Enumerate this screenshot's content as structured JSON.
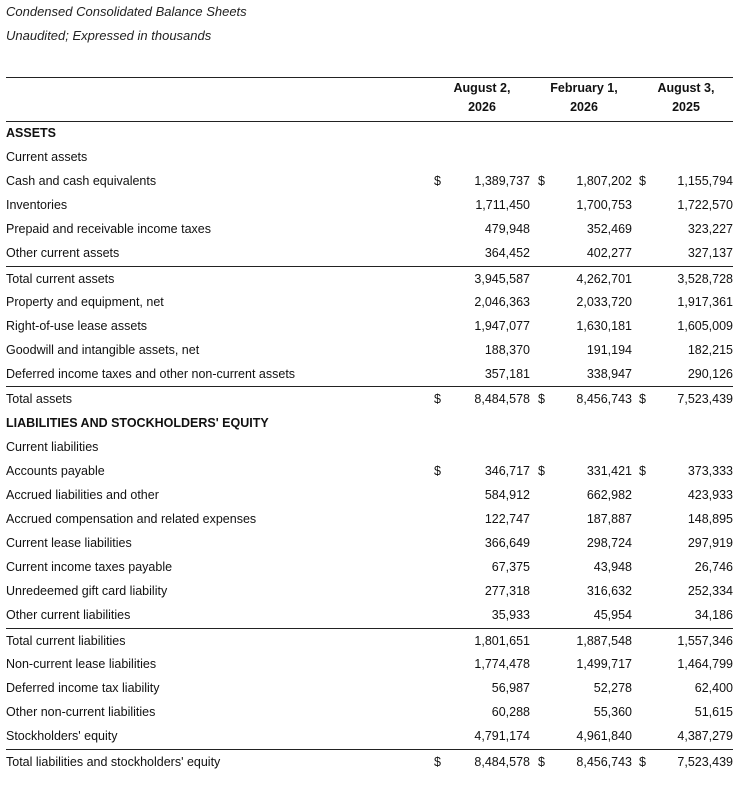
{
  "document": {
    "title": "Condensed Consolidated Balance Sheets",
    "subtitle": "Unaudited; Expressed in thousands"
  },
  "columns": [
    {
      "line1": "August 2,",
      "line2": "2026"
    },
    {
      "line1": "February 1,",
      "line2": "2026"
    },
    {
      "line1": "August 3,",
      "line2": "2025"
    }
  ],
  "rows": [
    {
      "label": "ASSETS",
      "type": "section"
    },
    {
      "label": "Current assets",
      "type": "subsection"
    },
    {
      "label": "Cash and cash equivalents",
      "values": [
        "1,389,737",
        "1,807,202",
        "1,155,794"
      ],
      "currency": [
        "$",
        "$",
        "$"
      ]
    },
    {
      "label": "Inventories",
      "values": [
        "1,711,450",
        "1,700,753",
        "1,722,570"
      ]
    },
    {
      "label": "Prepaid and receivable income taxes",
      "values": [
        "479,948",
        "352,469",
        "323,227"
      ]
    },
    {
      "label": "Other current assets",
      "values": [
        "364,452",
        "402,277",
        "327,137"
      ]
    },
    {
      "label": "Total current assets",
      "values": [
        "3,945,587",
        "4,262,701",
        "3,528,728"
      ],
      "total": true
    },
    {
      "label": "Property and equipment, net",
      "values": [
        "2,046,363",
        "2,033,720",
        "1,917,361"
      ]
    },
    {
      "label": "Right-of-use lease assets",
      "values": [
        "1,947,077",
        "1,630,181",
        "1,605,009"
      ]
    },
    {
      "label": "Goodwill and intangible assets, net",
      "values": [
        "188,370",
        "191,194",
        "182,215"
      ]
    },
    {
      "label": "Deferred income taxes and other non-current assets",
      "values": [
        "357,181",
        "338,947",
        "290,126"
      ]
    },
    {
      "label": "Total assets",
      "values": [
        "8,484,578",
        "8,456,743",
        "7,523,439"
      ],
      "currency": [
        "$",
        "$",
        "$"
      ],
      "total": true
    },
    {
      "label": "LIABILITIES AND STOCKHOLDERS' EQUITY",
      "type": "section"
    },
    {
      "label": "Current liabilities",
      "type": "subsection"
    },
    {
      "label": "Accounts payable",
      "values": [
        "346,717",
        "331,421",
        "373,333"
      ],
      "currency": [
        "$",
        "$",
        "$"
      ]
    },
    {
      "label": "Accrued liabilities and other",
      "values": [
        "584,912",
        "662,982",
        "423,933"
      ]
    },
    {
      "label": "Accrued compensation and related expenses",
      "values": [
        "122,747",
        "187,887",
        "148,895"
      ]
    },
    {
      "label": "Current lease liabilities",
      "values": [
        "366,649",
        "298,724",
        "297,919"
      ]
    },
    {
      "label": "Current income taxes payable",
      "values": [
        "67,375",
        "43,948",
        "26,746"
      ]
    },
    {
      "label": "Unredeemed gift card liability",
      "values": [
        "277,318",
        "316,632",
        "252,334"
      ]
    },
    {
      "label": "Other current liabilities",
      "values": [
        "35,933",
        "45,954",
        "34,186"
      ]
    },
    {
      "label": "Total current liabilities",
      "values": [
        "1,801,651",
        "1,887,548",
        "1,557,346"
      ],
      "total": true
    },
    {
      "label": "Non-current lease liabilities",
      "values": [
        "1,774,478",
        "1,499,717",
        "1,464,799"
      ]
    },
    {
      "label": "Deferred income tax liability",
      "values": [
        "56,987",
        "52,278",
        "62,400"
      ]
    },
    {
      "label": "Other non-current liabilities",
      "values": [
        "60,288",
        "55,360",
        "51,615"
      ]
    },
    {
      "label": "Stockholders' equity",
      "values": [
        "4,791,174",
        "4,961,840",
        "4,387,279"
      ]
    },
    {
      "label": "Total liabilities and stockholders' equity",
      "values": [
        "8,484,578",
        "8,456,743",
        "7,523,439"
      ],
      "currency": [
        "$",
        "$",
        "$"
      ],
      "total": true
    }
  ]
}
